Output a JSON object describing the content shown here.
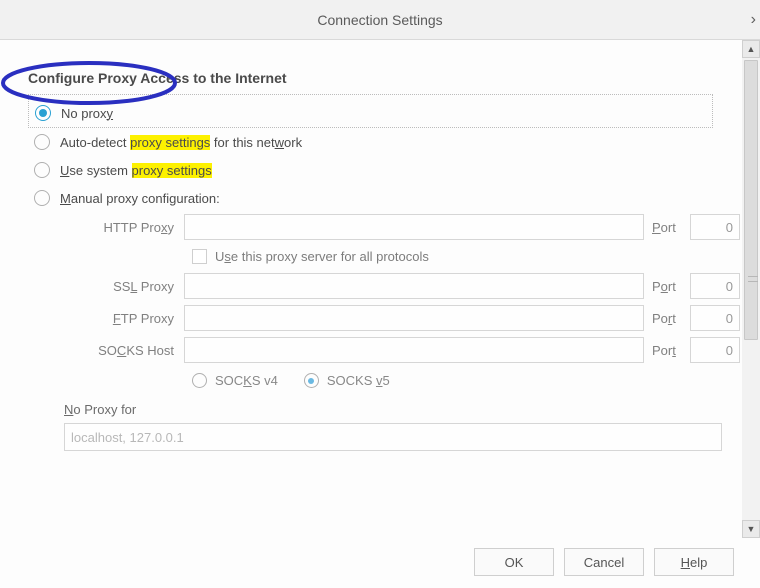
{
  "title": "Connection Settings",
  "section_heading": "Configure Proxy Access to the Internet",
  "options": {
    "no_proxy": {
      "pre": "No prox",
      "und": "y",
      "post": ""
    },
    "auto_detect": {
      "pre": "Auto-detect ",
      "hl": "proxy settings",
      "post": " for this net",
      "und": "w",
      "post2": "ork"
    },
    "use_system": {
      "pre": "",
      "und": "U",
      "post": "se system ",
      "hl": "proxy settings"
    },
    "manual": {
      "pre": "",
      "und": "M",
      "post": "anual proxy configuration:"
    }
  },
  "proxy": {
    "http_label_pre": "HTTP Pro",
    "http_label_und": "x",
    "http_label_post": "y",
    "ssl_label_pre": "SS",
    "ssl_label_und": "L",
    "ssl_label_post": " Proxy",
    "ftp_label_pre": "",
    "ftp_label_und": "F",
    "ftp_label_post": "TP Proxy",
    "socks_label_pre": "SO",
    "socks_label_und": "C",
    "socks_label_post": "KS Host",
    "port_label_pre": "",
    "port_label_und": "P",
    "port_label_post": "ort",
    "port_label2_pre": "P",
    "port_label2_und": "o",
    "port_label2_post": "rt",
    "port_label3_pre": "Po",
    "port_label3_und": "r",
    "port_label3_post": "t",
    "port_label4_pre": "Por",
    "port_label4_und": "t",
    "port_label4_post": "",
    "port_value": "0",
    "checkbox_pre": "U",
    "checkbox_und": "s",
    "checkbox_post": "e this proxy server for all protocols",
    "socks4_pre": "SOC",
    "socks4_und": "K",
    "socks4_post": "S v4",
    "socks5_pre": "SOCKS ",
    "socks5_und": "v",
    "socks5_post": "5"
  },
  "noproxy": {
    "label_pre": "",
    "label_und": "N",
    "label_post": "o Proxy for",
    "value": "localhost, 127.0.0.1"
  },
  "buttons": {
    "ok": "OK",
    "cancel": "Cancel",
    "help_und": "H",
    "help_post": "elp"
  }
}
